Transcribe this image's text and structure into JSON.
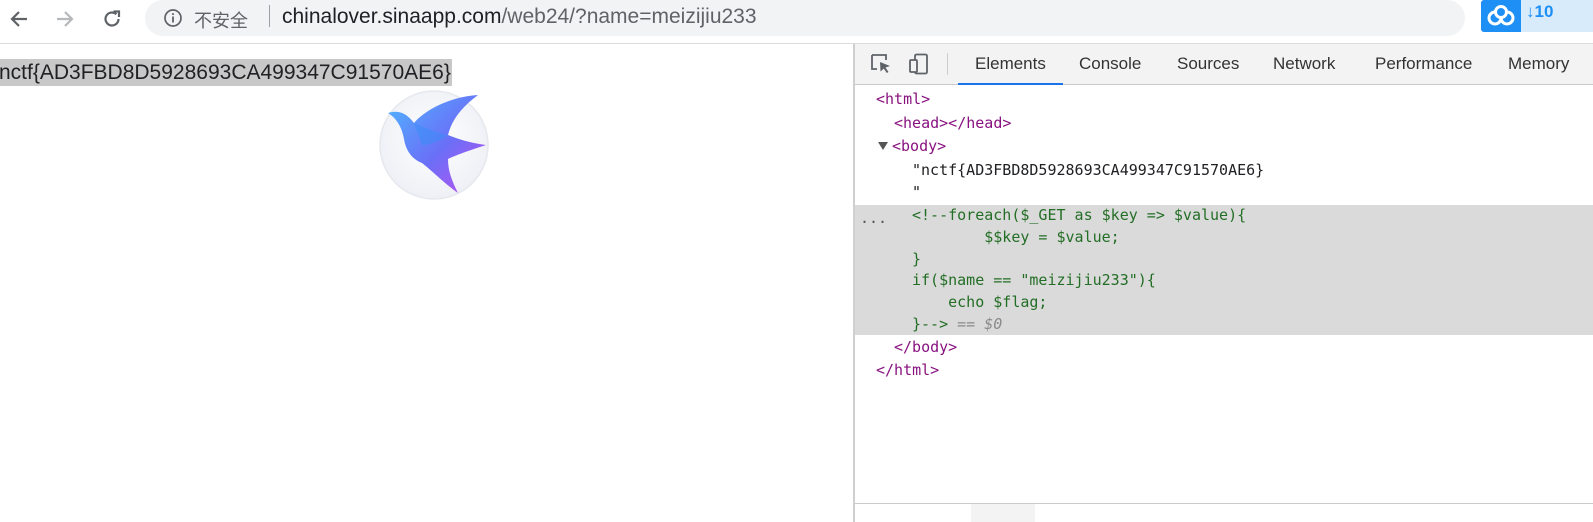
{
  "browser": {
    "security_label": "不安全",
    "url_host": "chinalover.sinaapp.com",
    "url_path": "/web24/?name=meizijiu233",
    "extension_badge": "10"
  },
  "page": {
    "flag_text": "nctf{AD3FBD8D5928693CA499347C91570AE6}"
  },
  "devtools": {
    "tabs": [
      "Elements",
      "Console",
      "Sources",
      "Network",
      "Performance",
      "Memory"
    ],
    "active_tab": "Elements",
    "dom_lines": {
      "html_open": "<html>",
      "head": "<head></head>",
      "body_open": "<body>",
      "text_node": "\"nctf{AD3FBD8D5928693CA499347C91570AE6}",
      "text_node_end": "\"",
      "comment_1": "<!--foreach($_GET as $key => $value){",
      "comment_2": "        $$key = $value;",
      "comment_3": "}",
      "comment_4": "if($name == \"meizijiu233\"){",
      "comment_5": "    echo $flag;",
      "comment_6": "}-->",
      "selection_marker": " == $0",
      "body_close": "</body>",
      "html_close": "</html>",
      "row_menu": "..."
    }
  }
}
